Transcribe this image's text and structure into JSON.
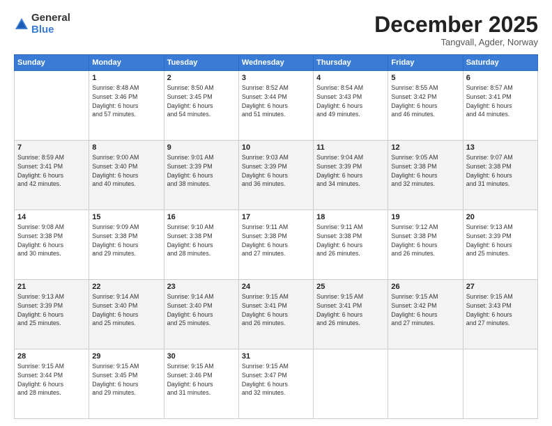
{
  "logo": {
    "general": "General",
    "blue": "Blue"
  },
  "title": "December 2025",
  "location": "Tangvall, Agder, Norway",
  "days_of_week": [
    "Sunday",
    "Monday",
    "Tuesday",
    "Wednesday",
    "Thursday",
    "Friday",
    "Saturday"
  ],
  "weeks": [
    [
      {
        "num": "",
        "info": ""
      },
      {
        "num": "1",
        "info": "Sunrise: 8:48 AM\nSunset: 3:46 PM\nDaylight: 6 hours\nand 57 minutes."
      },
      {
        "num": "2",
        "info": "Sunrise: 8:50 AM\nSunset: 3:45 PM\nDaylight: 6 hours\nand 54 minutes."
      },
      {
        "num": "3",
        "info": "Sunrise: 8:52 AM\nSunset: 3:44 PM\nDaylight: 6 hours\nand 51 minutes."
      },
      {
        "num": "4",
        "info": "Sunrise: 8:54 AM\nSunset: 3:43 PM\nDaylight: 6 hours\nand 49 minutes."
      },
      {
        "num": "5",
        "info": "Sunrise: 8:55 AM\nSunset: 3:42 PM\nDaylight: 6 hours\nand 46 minutes."
      },
      {
        "num": "6",
        "info": "Sunrise: 8:57 AM\nSunset: 3:41 PM\nDaylight: 6 hours\nand 44 minutes."
      }
    ],
    [
      {
        "num": "7",
        "info": "Sunrise: 8:59 AM\nSunset: 3:41 PM\nDaylight: 6 hours\nand 42 minutes."
      },
      {
        "num": "8",
        "info": "Sunrise: 9:00 AM\nSunset: 3:40 PM\nDaylight: 6 hours\nand 40 minutes."
      },
      {
        "num": "9",
        "info": "Sunrise: 9:01 AM\nSunset: 3:39 PM\nDaylight: 6 hours\nand 38 minutes."
      },
      {
        "num": "10",
        "info": "Sunrise: 9:03 AM\nSunset: 3:39 PM\nDaylight: 6 hours\nand 36 minutes."
      },
      {
        "num": "11",
        "info": "Sunrise: 9:04 AM\nSunset: 3:39 PM\nDaylight: 6 hours\nand 34 minutes."
      },
      {
        "num": "12",
        "info": "Sunrise: 9:05 AM\nSunset: 3:38 PM\nDaylight: 6 hours\nand 32 minutes."
      },
      {
        "num": "13",
        "info": "Sunrise: 9:07 AM\nSunset: 3:38 PM\nDaylight: 6 hours\nand 31 minutes."
      }
    ],
    [
      {
        "num": "14",
        "info": "Sunrise: 9:08 AM\nSunset: 3:38 PM\nDaylight: 6 hours\nand 30 minutes."
      },
      {
        "num": "15",
        "info": "Sunrise: 9:09 AM\nSunset: 3:38 PM\nDaylight: 6 hours\nand 29 minutes."
      },
      {
        "num": "16",
        "info": "Sunrise: 9:10 AM\nSunset: 3:38 PM\nDaylight: 6 hours\nand 28 minutes."
      },
      {
        "num": "17",
        "info": "Sunrise: 9:11 AM\nSunset: 3:38 PM\nDaylight: 6 hours\nand 27 minutes."
      },
      {
        "num": "18",
        "info": "Sunrise: 9:11 AM\nSunset: 3:38 PM\nDaylight: 6 hours\nand 26 minutes."
      },
      {
        "num": "19",
        "info": "Sunrise: 9:12 AM\nSunset: 3:38 PM\nDaylight: 6 hours\nand 26 minutes."
      },
      {
        "num": "20",
        "info": "Sunrise: 9:13 AM\nSunset: 3:39 PM\nDaylight: 6 hours\nand 25 minutes."
      }
    ],
    [
      {
        "num": "21",
        "info": "Sunrise: 9:13 AM\nSunset: 3:39 PM\nDaylight: 6 hours\nand 25 minutes."
      },
      {
        "num": "22",
        "info": "Sunrise: 9:14 AM\nSunset: 3:40 PM\nDaylight: 6 hours\nand 25 minutes."
      },
      {
        "num": "23",
        "info": "Sunrise: 9:14 AM\nSunset: 3:40 PM\nDaylight: 6 hours\nand 25 minutes."
      },
      {
        "num": "24",
        "info": "Sunrise: 9:15 AM\nSunset: 3:41 PM\nDaylight: 6 hours\nand 26 minutes."
      },
      {
        "num": "25",
        "info": "Sunrise: 9:15 AM\nSunset: 3:41 PM\nDaylight: 6 hours\nand 26 minutes."
      },
      {
        "num": "26",
        "info": "Sunrise: 9:15 AM\nSunset: 3:42 PM\nDaylight: 6 hours\nand 27 minutes."
      },
      {
        "num": "27",
        "info": "Sunrise: 9:15 AM\nSunset: 3:43 PM\nDaylight: 6 hours\nand 27 minutes."
      }
    ],
    [
      {
        "num": "28",
        "info": "Sunrise: 9:15 AM\nSunset: 3:44 PM\nDaylight: 6 hours\nand 28 minutes."
      },
      {
        "num": "29",
        "info": "Sunrise: 9:15 AM\nSunset: 3:45 PM\nDaylight: 6 hours\nand 29 minutes."
      },
      {
        "num": "30",
        "info": "Sunrise: 9:15 AM\nSunset: 3:46 PM\nDaylight: 6 hours\nand 31 minutes."
      },
      {
        "num": "31",
        "info": "Sunrise: 9:15 AM\nSunset: 3:47 PM\nDaylight: 6 hours\nand 32 minutes."
      },
      {
        "num": "",
        "info": ""
      },
      {
        "num": "",
        "info": ""
      },
      {
        "num": "",
        "info": ""
      }
    ]
  ]
}
